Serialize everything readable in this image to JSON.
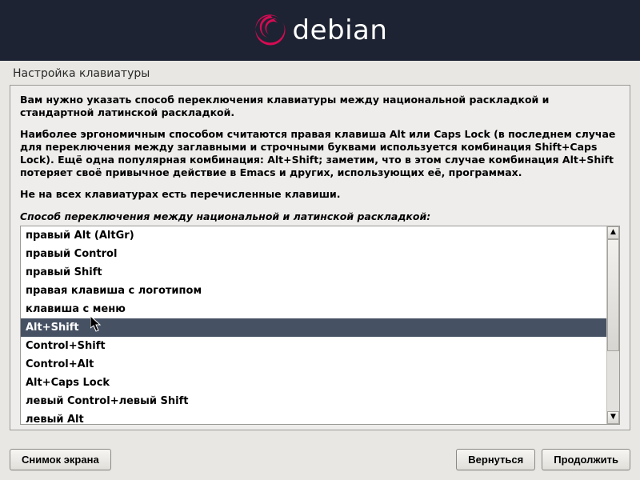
{
  "header": {
    "logo_text": "debian"
  },
  "page_title": "Настройка клавиатуры",
  "instructions": {
    "p1": "Вам нужно указать способ переключения клавиатуры между национальной раскладкой и стандартной латинской раскладкой.",
    "p2": "Наиболее эргономичным способом считаются правая клавиша Alt или Caps Lock (в последнем случае для переключения между заглавными и строчными буквами используется комбинация Shift+Caps Lock). Ещё одна популярная комбинация: Alt+Shift; заметим, что в этом случае комбинация Alt+Shift потеряет своё привычное действие в Emacs и других, использующих её, программах.",
    "p3": "Не на всех клавиатурах есть перечисленные клавиши."
  },
  "prompt_label": "Способ переключения между национальной и латинской раскладкой:",
  "options": [
    "правый Alt (AltGr)",
    "правый Control",
    "правый Shift",
    "правая клавиша с логотипом",
    "клавиша с меню",
    "Alt+Shift",
    "Control+Shift",
    "Control+Alt",
    "Alt+Caps Lock",
    "левый Control+левый Shift",
    "левый Alt"
  ],
  "selected_index": 5,
  "footer": {
    "screenshot": "Снимок экрана",
    "back": "Вернуться",
    "continue": "Продолжить"
  }
}
